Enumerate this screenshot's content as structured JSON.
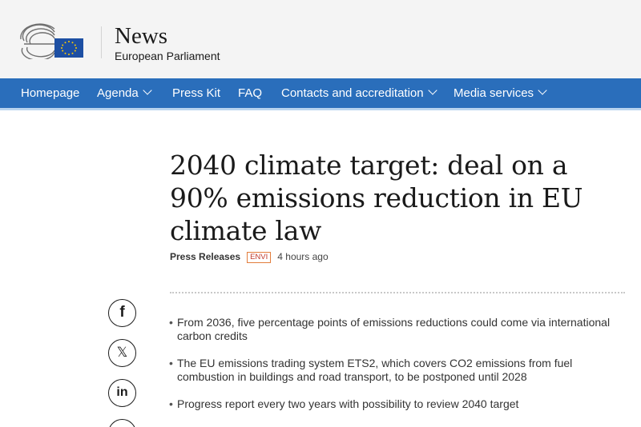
{
  "header": {
    "title": "News",
    "subtitle": "European Parliament",
    "logo_icon": "european-parliament-logo-icon",
    "colors": {
      "background": "#f4f4f4",
      "eu_flag_blue": "#1d4fa3",
      "eu_flag_stars": "#ffcc00"
    }
  },
  "nav": {
    "background": "#2a6ebb",
    "items": [
      {
        "label": "Homepage",
        "dropdown": false
      },
      {
        "label": "Agenda",
        "dropdown": true
      },
      {
        "label": "Press Kit",
        "dropdown": false
      },
      {
        "label": "FAQ",
        "dropdown": false
      },
      {
        "label": "Contacts and accreditation",
        "dropdown": true
      },
      {
        "label": "Media services",
        "dropdown": true
      }
    ]
  },
  "article": {
    "title": "2040 climate target: deal on a 90% emissions reduction in EU climate law",
    "category": "Press Releases",
    "badge": "ENVI",
    "time": "4 hours ago",
    "bullets": [
      "From 2036, five percentage points of emissions reductions could come via international carbon credits",
      "The EU emissions trading system ETS2, which covers CO2 emissions from fuel combustion in buildings and road transport, to be postponed until 2028",
      "Progress report every two years with possibility to review 2040 target"
    ]
  },
  "share": [
    {
      "icon": "facebook-icon",
      "glyph": "f"
    },
    {
      "icon": "x-icon",
      "glyph": "𝕏"
    },
    {
      "icon": "linkedin-icon",
      "glyph": "in"
    },
    {
      "icon": "more-share-icon",
      "glyph": ""
    }
  ]
}
